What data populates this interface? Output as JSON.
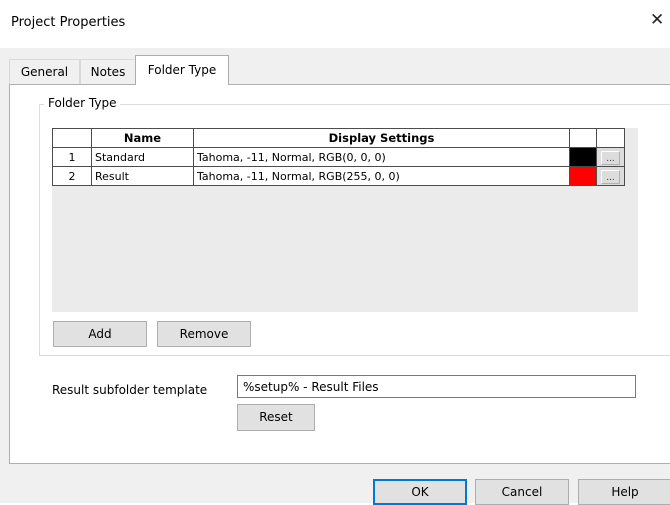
{
  "window": {
    "title": "Project Properties",
    "close_glyph": "✕"
  },
  "tabs": [
    {
      "label": "General",
      "active": false
    },
    {
      "label": "Notes",
      "active": false
    },
    {
      "label": "Folder Type",
      "active": true
    }
  ],
  "folder_type": {
    "group_label": "Folder Type",
    "columns": [
      "Name",
      "Display Settings"
    ],
    "rows": [
      {
        "num": "1",
        "name": "Standard",
        "display": "Tahoma, -11, Normal, RGB(0, 0, 0)",
        "color": "#000000",
        "browse_label": "..."
      },
      {
        "num": "2",
        "name": "Result",
        "display": "Tahoma, -11, Normal, RGB(255, 0, 0)",
        "color": "#ff0000",
        "browse_label": "..."
      }
    ],
    "add_label": "Add",
    "remove_label": "Remove"
  },
  "result_subfolder": {
    "label": "Result subfolder template",
    "value": "%setup% - Result Files",
    "reset_label": "Reset"
  },
  "footer": {
    "ok_label": "OK",
    "cancel_label": "Cancel",
    "help_label": "Help"
  }
}
